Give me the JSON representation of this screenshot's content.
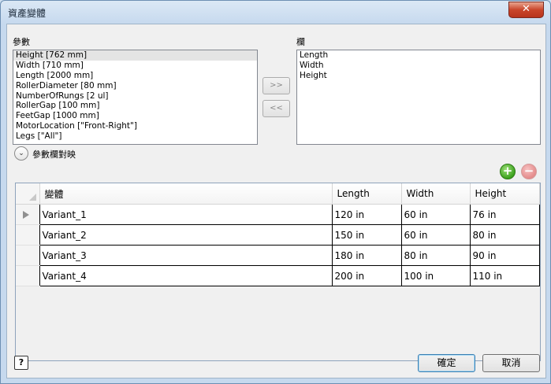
{
  "window": {
    "title": "資產變體",
    "close_glyph": "✕"
  },
  "parameters": {
    "label": "參數",
    "items": [
      "Height [762 mm]",
      "Width [710 mm]",
      "Length [2000 mm]",
      "RollerDiameter [80 mm]",
      "NumberOfRungs [2 ul]",
      "RollerGap [100 mm]",
      "FeetGap [1000 mm]",
      "MotorLocation [\"Front-Right\"]",
      "Legs [\"All\"]"
    ]
  },
  "columns_list": {
    "label": "欄",
    "items": [
      "Length",
      "Width",
      "Height"
    ]
  },
  "transfer": {
    "add_label": ">>",
    "remove_label": "<<"
  },
  "mapping": {
    "label": "參數欄對映",
    "chevron_glyph": "⌄"
  },
  "row_actions": {
    "add_glyph": "+",
    "remove_glyph": "−"
  },
  "table": {
    "headers": [
      "變體",
      "Length",
      "Width",
      "Height"
    ],
    "rows": [
      [
        "Variant_1",
        "120 in",
        "60 in",
        "76 in"
      ],
      [
        "Variant_2",
        "150 in",
        "60 in",
        "80 in"
      ],
      [
        "Variant_3",
        "180 in",
        "80 in",
        "90 in"
      ],
      [
        "Variant_4",
        "200 in",
        "100 in",
        "110 in"
      ]
    ]
  },
  "footer": {
    "help_glyph": "?",
    "ok_label": "確定",
    "cancel_label": "取消"
  }
}
